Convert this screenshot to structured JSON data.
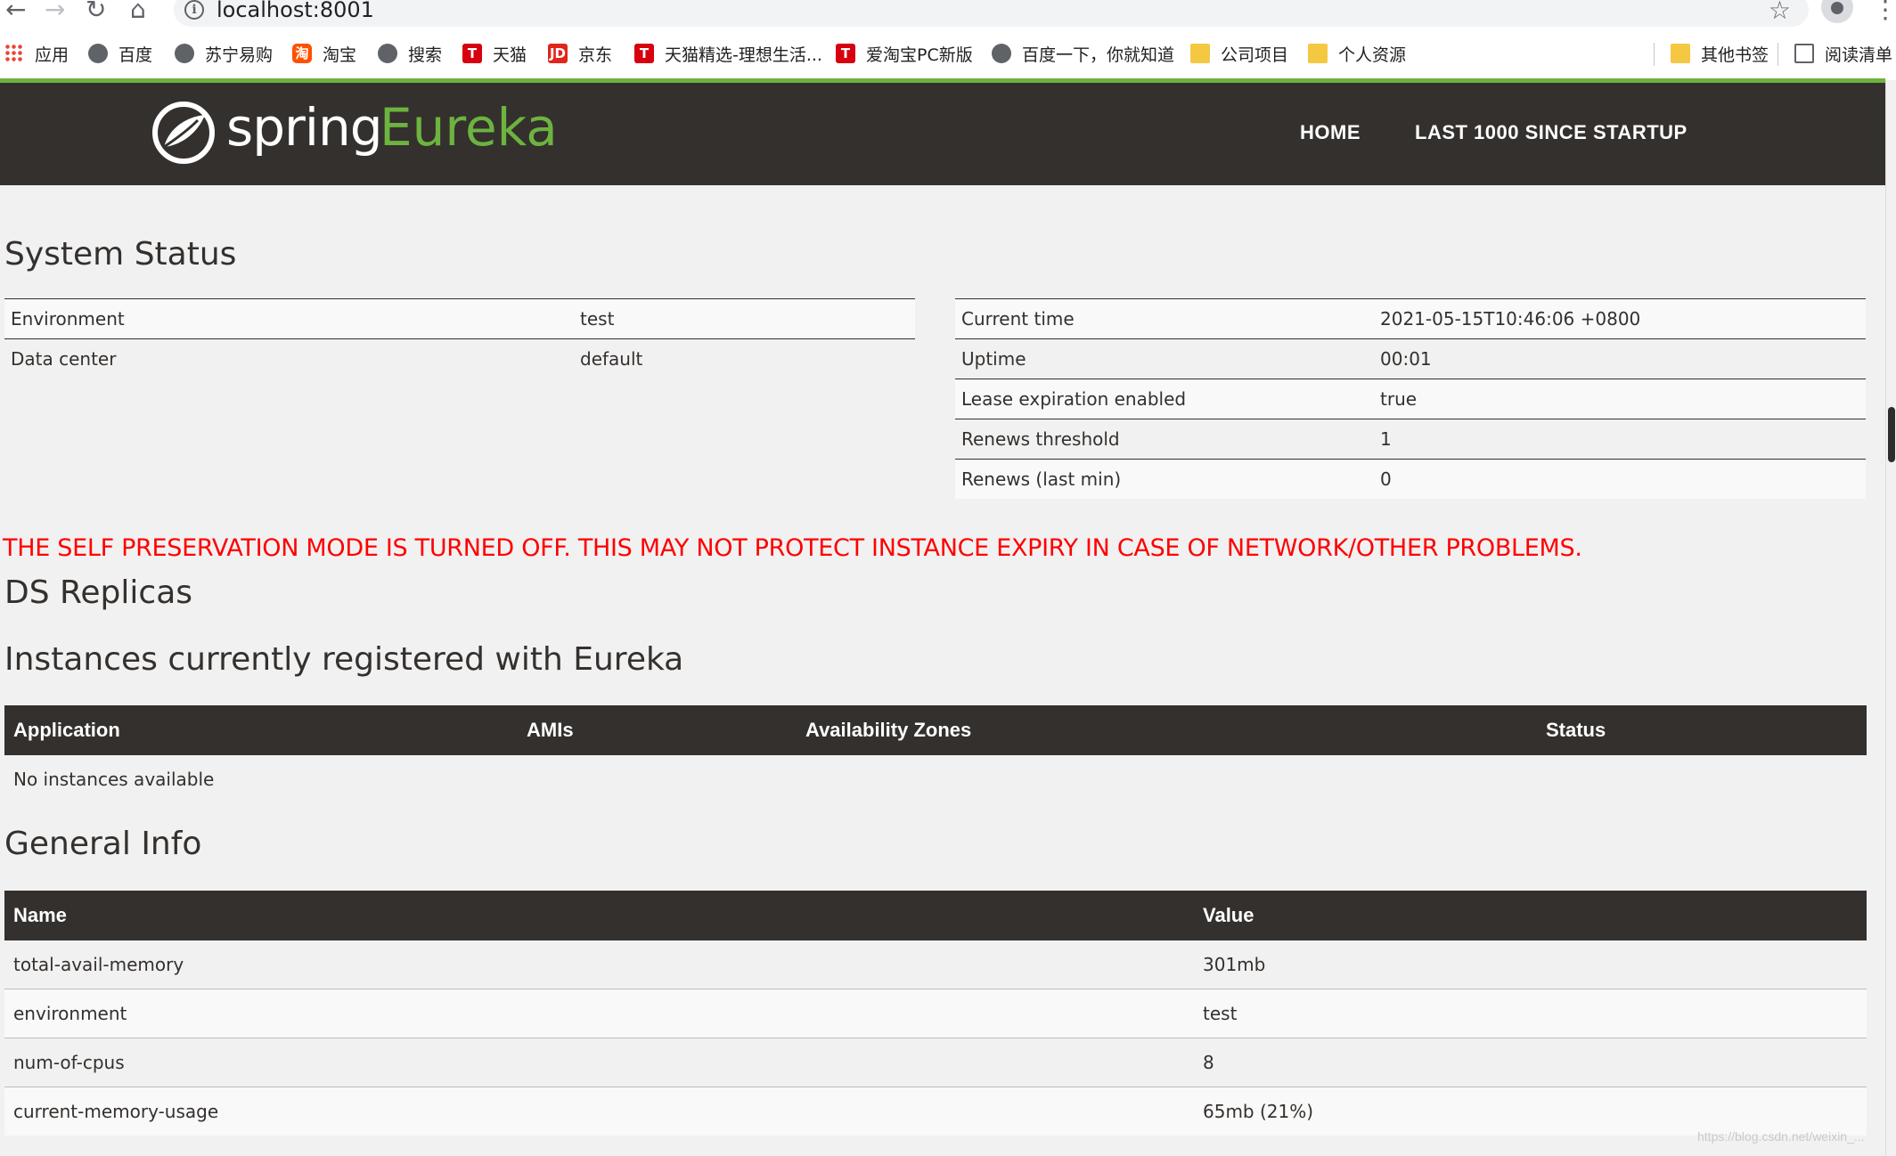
{
  "browser": {
    "url": "localhost:8001",
    "bookmarks": [
      {
        "label": "应用",
        "icon": "apps-grid-icon"
      },
      {
        "label": "百度",
        "icon": "globe-icon"
      },
      {
        "label": "苏宁易购",
        "icon": "globe-icon"
      },
      {
        "label": "淘宝",
        "icon": "taobao-icon"
      },
      {
        "label": "搜索",
        "icon": "globe-icon"
      },
      {
        "label": "天猫",
        "icon": "tmall-icon"
      },
      {
        "label": "京东",
        "icon": "jd-icon"
      },
      {
        "label": "天猫精选-理想生活...",
        "icon": "tmall-icon"
      },
      {
        "label": "爱淘宝PC新版",
        "icon": "tmall-icon"
      },
      {
        "label": "百度一下，你就知道",
        "icon": "globe-icon"
      },
      {
        "label": "公司项目",
        "icon": "folder-icon"
      },
      {
        "label": "个人资源",
        "icon": "folder-icon"
      },
      {
        "label": "其他书签",
        "icon": "folder-icon"
      },
      {
        "label": "阅读清单",
        "icon": "reading-list-icon"
      }
    ]
  },
  "header": {
    "logo_spring": "spring",
    "logo_eureka": "Eureka",
    "nav": {
      "home": "HOME",
      "last1000": "LAST 1000 SINCE STARTUP"
    }
  },
  "system_status": {
    "title": "System Status",
    "left": [
      {
        "name": "Environment",
        "value": "test"
      },
      {
        "name": "Data center",
        "value": "default"
      }
    ],
    "right": [
      {
        "name": "Current time",
        "value": "2021-05-15T10:46:06 +0800"
      },
      {
        "name": "Uptime",
        "value": "00:01"
      },
      {
        "name": "Lease expiration enabled",
        "value": "true"
      },
      {
        "name": "Renews threshold",
        "value": "1"
      },
      {
        "name": "Renews (last min)",
        "value": "0"
      }
    ]
  },
  "warning": "THE SELF PRESERVATION MODE IS TURNED OFF. THIS MAY NOT PROTECT INSTANCE EXPIRY IN CASE OF NETWORK/OTHER PROBLEMS.",
  "ds_replicas": {
    "title": "DS Replicas"
  },
  "instances": {
    "title": "Instances currently registered with Eureka",
    "headers": [
      "Application",
      "AMIs",
      "Availability Zones",
      "Status"
    ],
    "empty_text": "No instances available"
  },
  "general_info": {
    "title": "General Info",
    "headers": [
      "Name",
      "Value"
    ],
    "rows": [
      {
        "name": "total-avail-memory",
        "value": "301mb"
      },
      {
        "name": "environment",
        "value": "test"
      },
      {
        "name": "num-of-cpus",
        "value": "8"
      },
      {
        "name": "current-memory-usage",
        "value": "65mb (21%)"
      }
    ]
  },
  "watermark": "https://blog.csdn.net/weixin_..."
}
